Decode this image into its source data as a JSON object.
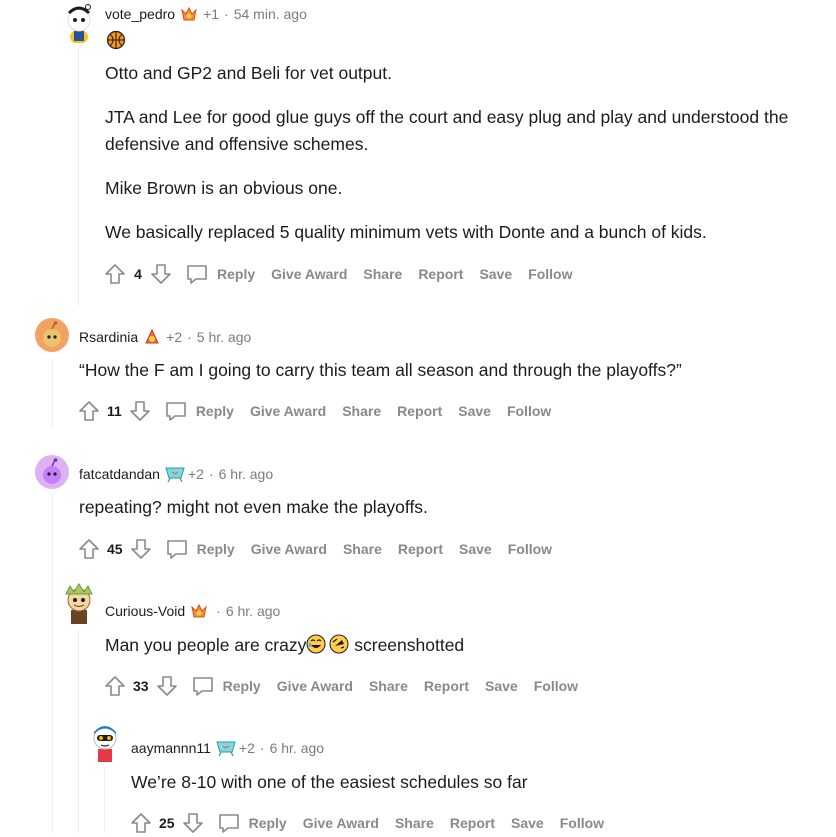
{
  "labels": {
    "reply": "Reply",
    "give_award": "Give Award",
    "share": "Share",
    "report": "Report",
    "save": "Save",
    "follow": "Follow"
  },
  "comments": [
    {
      "username": "vote_pedro",
      "score_badge": "+1",
      "time": "54 min. ago",
      "paragraphs": [
        "Otto and GP2 and Beli for vet output.",
        "JTA and Lee for good glue guys off the court and easy plug and play and understood the defensive and offensive schemes.",
        "Mike Brown is an obvious one.",
        "We basically replaced 5 quality minimum vets with Donte and a bunch of kids."
      ],
      "votes": "4"
    },
    {
      "username": "Rsardinia",
      "score_badge": "+2",
      "time": "5 hr. ago",
      "paragraphs": [
        "“How the F am I going to carry this team all season and through the playoffs?”"
      ],
      "votes": "11"
    },
    {
      "username": "fatcatdandan",
      "score_badge": "+2",
      "time": "6 hr. ago",
      "paragraphs": [
        "repeating? might not even make the playoffs."
      ],
      "votes": "45"
    },
    {
      "username": "Curious-Void",
      "score_badge": "",
      "time": "6 hr. ago",
      "text_before_emoji": "Man you people are crazy",
      "text_after_emoji": " screenshotted",
      "votes": "33"
    },
    {
      "username": "aaymannn11",
      "score_badge": "+2",
      "time": "6 hr. ago",
      "paragraphs": [
        "We’re 8-10 with one of the easiest schedules so far"
      ],
      "votes": "25"
    }
  ]
}
